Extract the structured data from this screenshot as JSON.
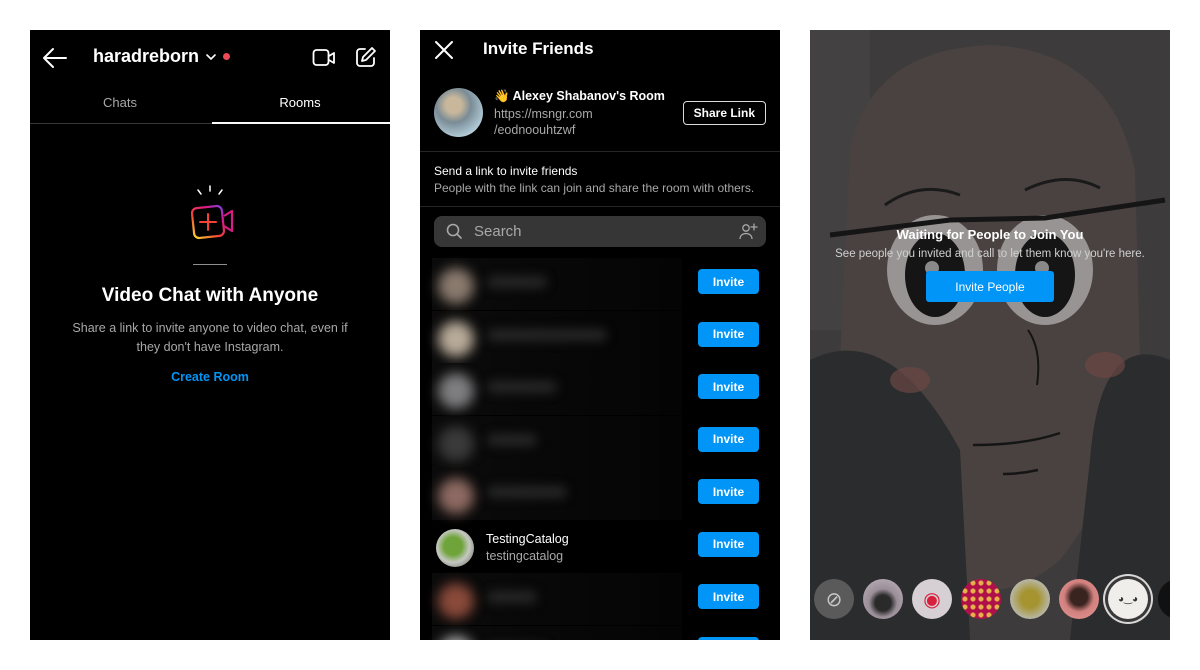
{
  "panel1": {
    "username": "haradreborn",
    "status_color": "#ed4956",
    "icons": {
      "back": "arrow-left-icon",
      "dropdown": "chevron-down-icon",
      "video": "video-camera-icon",
      "compose": "compose-icon"
    },
    "tabs": [
      {
        "label": "Chats",
        "active": false
      },
      {
        "label": "Rooms",
        "active": true
      }
    ],
    "empty_state": {
      "icon": "video-plus-icon",
      "title": "Video Chat with Anyone",
      "description": "Share a link to invite anyone to video chat, even if they don't have Instagram.",
      "cta": "Create Room"
    }
  },
  "panel2": {
    "title": "Invite Friends",
    "close_icon": "close-icon",
    "room": {
      "emoji": "👋",
      "name": "Alexey Shabanov's Room",
      "link_line1": "https://msngr.com",
      "link_line2": "/eodnoouhtzwf",
      "share_label": "Share Link"
    },
    "send_title": "Send a link to invite friends",
    "send_subtitle": "People with the link can join and share the room with others.",
    "search": {
      "placeholder": "Search",
      "value": ""
    },
    "invite_label": "Invite",
    "contacts": [
      {
        "blurred": true,
        "name": "",
        "username": ""
      },
      {
        "blurred": true,
        "name": "",
        "username": ""
      },
      {
        "blurred": true,
        "name": "",
        "username": ""
      },
      {
        "blurred": true,
        "name": "",
        "username": ""
      },
      {
        "blurred": true,
        "name": "",
        "username": ""
      },
      {
        "blurred": false,
        "name": "TestingCatalog",
        "username": "testingcatalog"
      },
      {
        "blurred": true,
        "name": "",
        "username": ""
      },
      {
        "blurred": true,
        "name": "",
        "username": ""
      }
    ],
    "accent_color": "#0095f6"
  },
  "panel3": {
    "title": "Waiting for People to Join You",
    "description": "See people you invited and call to let them know you're here.",
    "button_label": "Invite People",
    "effects": [
      {
        "name": "no-effect",
        "selected": false
      },
      {
        "name": "bird-effect",
        "selected": false
      },
      {
        "name": "camera-frame-effect",
        "selected": false
      },
      {
        "name": "glitter-effect",
        "selected": false
      },
      {
        "name": "gold-sparkle-effect",
        "selected": false
      },
      {
        "name": "person-effect",
        "selected": false
      },
      {
        "name": "anime-face-effect",
        "selected": true
      }
    ]
  }
}
